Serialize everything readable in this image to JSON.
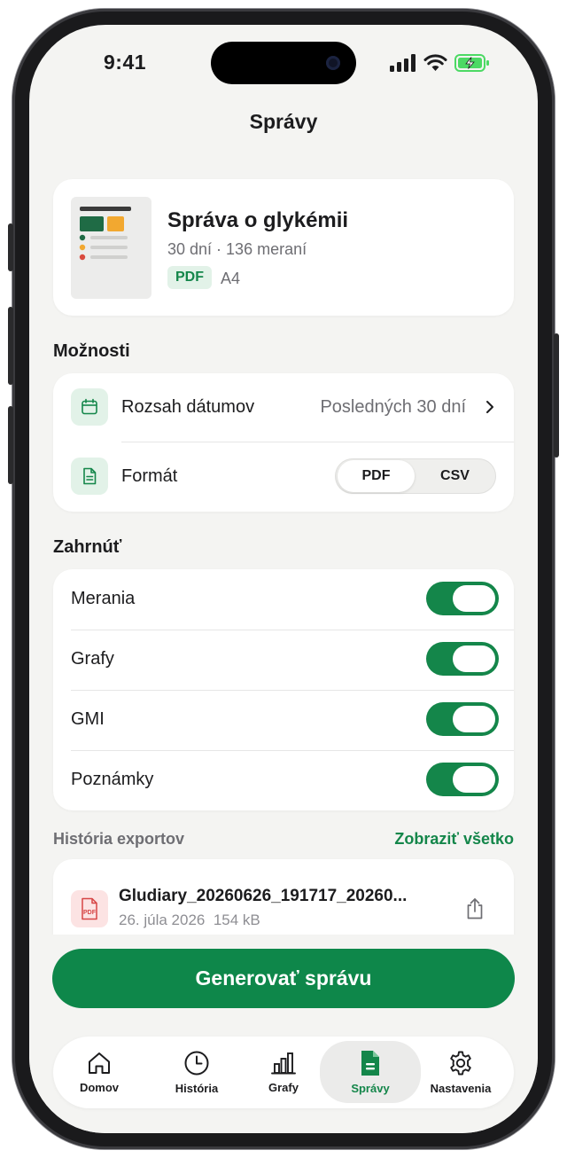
{
  "status": {
    "time": "9:41"
  },
  "header": {
    "title": "Správy"
  },
  "report": {
    "title": "Správa o glykémii",
    "subtitle": "30 dní · 136 meraní",
    "format_badge": "PDF",
    "paper_size": "A4"
  },
  "options": {
    "section_title": "Možnosti",
    "date_range": {
      "label": "Rozsah dátumov",
      "value": "Posledných 30 dní"
    },
    "format": {
      "label": "Formát",
      "options": [
        "PDF",
        "CSV"
      ],
      "selected": "PDF"
    }
  },
  "include": {
    "section_title": "Zahrnúť",
    "items": [
      {
        "label": "Merania",
        "on": true
      },
      {
        "label": "Grafy",
        "on": true
      },
      {
        "label": "GMI",
        "on": true
      },
      {
        "label": "Poznámky",
        "on": true
      }
    ]
  },
  "history": {
    "section_title": "História exportov",
    "show_all": "Zobraziť všetko",
    "items": [
      {
        "icon_text": "PDF",
        "name": "Gludiary_20260626_191717_20260...",
        "date": "26. júla 2026",
        "size": "154 kB"
      }
    ]
  },
  "actions": {
    "generate": "Generovať správu"
  },
  "tabbar": {
    "items": [
      {
        "label": "Domov",
        "icon": "home-icon"
      },
      {
        "label": "História",
        "icon": "clock-icon"
      },
      {
        "label": "Grafy",
        "icon": "bar-chart-icon"
      },
      {
        "label": "Správy",
        "icon": "document-icon",
        "active": true
      },
      {
        "label": "Nastavenia",
        "icon": "gear-icon"
      }
    ]
  },
  "colors": {
    "accent": "#0e874a",
    "accent_light": "#e2f2e8",
    "background": "#f4f4f2",
    "pdf_red": "#d64545"
  }
}
